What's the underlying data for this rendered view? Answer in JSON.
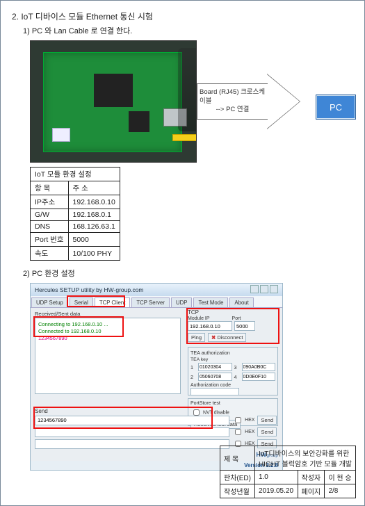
{
  "section": {
    "title": "2. IoT 디바이스 모듈 Ethernet 통신 시험",
    "step1": "1) PC 와 Lan Cable 로 연결 한다.",
    "step2": "2) PC 환경 설정"
  },
  "arrow": {
    "line1": "Board (RJ45) 크로스케이블",
    "line2": "-->        PC 연결",
    "pc_label": "PC"
  },
  "iot_table": {
    "caption": "IoT 모듈 환경 설정",
    "h_item": "항 목",
    "h_addr": "주 소",
    "rows": [
      {
        "k": "IP주소",
        "v": "192.168.0.10"
      },
      {
        "k": "G/W",
        "v": "192.168.0.1"
      },
      {
        "k": "DNS",
        "v": "168.126.63.1"
      },
      {
        "k": "Port 번호",
        "v": "5000"
      },
      {
        "k": "속도",
        "v": "10/100 PHY"
      }
    ]
  },
  "hercules": {
    "title": "Hercules SETUP utility by HW-group.com",
    "tabs": [
      "UDP Setup",
      "Serial",
      "TCP Client",
      "TCP Server",
      "UDP",
      "Test Mode",
      "About"
    ],
    "active_tab": 2,
    "conn_label": "Received/Sent data",
    "conn_line1": "Connecting to 192.168.0.10 ...",
    "conn_line2": "Connected to 192.168.0.10",
    "conn_line3": "1234567890",
    "tcp": {
      "hdr": "TCP",
      "module_label": "Module IP",
      "port_label": "Port",
      "ip": "192.168.0.10",
      "port": "5000",
      "ping": "Ping",
      "disconnect": "Disconnect"
    },
    "tea": {
      "hdr": "TEA authorization",
      "key_label": "TEA key",
      "k": [
        "01020304",
        "05060708",
        "090A0B0C",
        "0D0E0F10"
      ],
      "auth_label": "Authorization code"
    },
    "pv": {
      "hdr": "PortStore test",
      "nvt": "NVT disable",
      "recv": "Received test data"
    },
    "send": {
      "label": "Send",
      "value": "1234567890",
      "hex": "HEX",
      "btn": "Send"
    },
    "logo": "HW",
    "logo_sub": "group",
    "logo_caption": "Hercules SETUP utility",
    "version": "Version 3.2.8"
  },
  "footer": {
    "title_label": "제    목",
    "title_value": "IoT디바이스의 보안강화를 위한\nHIGHT 블럭암호 기반 모듈 개발",
    "ed_label": "판차(ED)",
    "ed_value": "1.0",
    "author_label": "작성자",
    "author_value": "이 현 승",
    "date_label": "작성년월",
    "date_value": "2019.05.20",
    "page_label": "페이지",
    "page_value": "2/8"
  }
}
